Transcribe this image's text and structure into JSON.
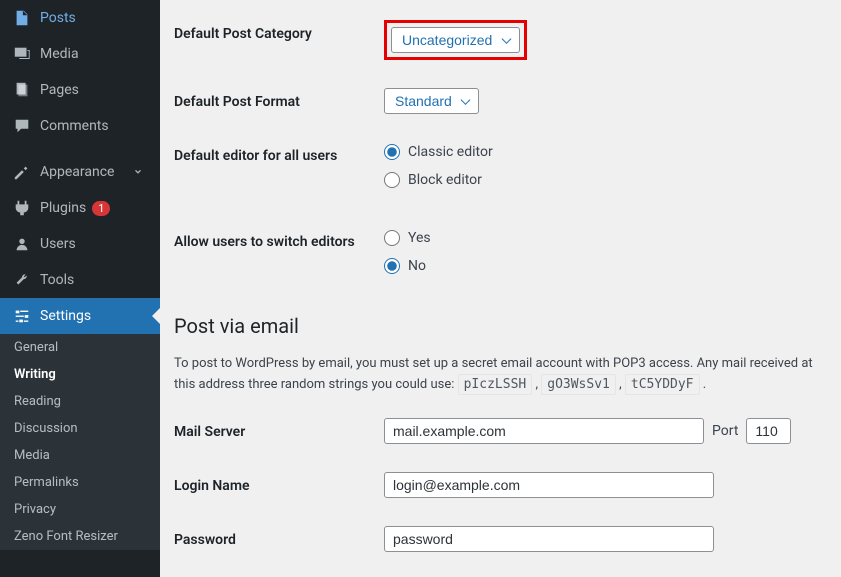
{
  "sidebar": {
    "items": [
      {
        "label": "Posts",
        "icon": "posts"
      },
      {
        "label": "Media",
        "icon": "media"
      },
      {
        "label": "Pages",
        "icon": "pages"
      },
      {
        "label": "Comments",
        "icon": "comments"
      },
      {
        "label": "Appearance",
        "icon": "appearance"
      },
      {
        "label": "Plugins",
        "icon": "plugins",
        "badge": "1"
      },
      {
        "label": "Users",
        "icon": "users"
      },
      {
        "label": "Tools",
        "icon": "tools"
      },
      {
        "label": "Settings",
        "icon": "settings"
      }
    ],
    "submenu": {
      "items": [
        "General",
        "Writing",
        "Reading",
        "Discussion",
        "Media",
        "Permalinks",
        "Privacy",
        "Zeno Font Resizer"
      ],
      "current": "Writing"
    }
  },
  "settings": {
    "default_post_category": {
      "label": "Default Post Category",
      "value": "Uncategorized"
    },
    "default_post_format": {
      "label": "Default Post Format",
      "value": "Standard"
    },
    "default_editor": {
      "label": "Default editor for all users",
      "options": {
        "classic": "Classic editor",
        "block": "Block editor"
      },
      "selected": "classic"
    },
    "allow_switch": {
      "label": "Allow users to switch editors",
      "options": {
        "yes": "Yes",
        "no": "No"
      },
      "selected": "no"
    }
  },
  "post_via_email": {
    "heading": "Post via email",
    "desc_prefix": "To post to WordPress by email, you must set up a secret email account with POP3 access. Any mail received at this address three random strings you could use: ",
    "codes": [
      "pIczLSSH",
      "gO3WsSv1",
      "tC5YDDyF"
    ],
    "mail_server": {
      "label": "Mail Server",
      "value": "mail.example.com"
    },
    "port": {
      "label": "Port",
      "value": "110"
    },
    "login_name": {
      "label": "Login Name",
      "value": "login@example.com"
    },
    "password": {
      "label": "Password",
      "value": "password"
    }
  }
}
